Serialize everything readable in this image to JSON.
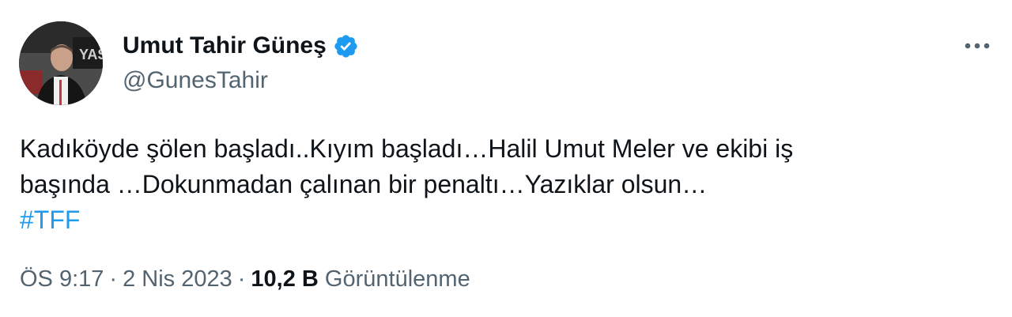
{
  "author": {
    "display_name": "Umut Tahir Güneş",
    "handle": "@GunesTahir",
    "verified": true,
    "avatar_icon": "profile-photo"
  },
  "menu": {
    "more_icon": "more-horizontal-icon"
  },
  "tweet": {
    "text_line_1": "Kadıköyde şölen başladı..Kıyım başladı…Halil Umut Meler ve ekibi iş",
    "text_line_2": "başında …Dokunmadan çalınan bir penaltı…Yazıklar olsun…",
    "hashtag": "#TFF"
  },
  "meta": {
    "time": "ÖS 9:17",
    "separator": "·",
    "date": "2 Nis 2023",
    "views_count": "10,2 B",
    "views_label": "Görüntülenme"
  },
  "colors": {
    "text": "#0f1419",
    "secondary": "#536471",
    "accent": "#1d9bf0"
  }
}
